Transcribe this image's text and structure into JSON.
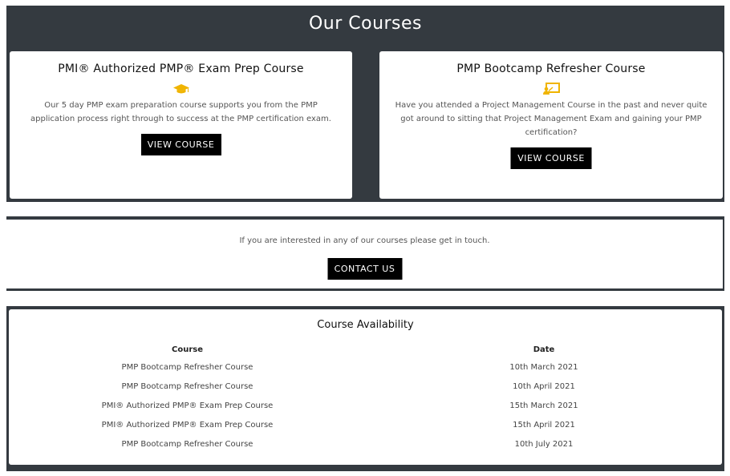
{
  "courses": {
    "title": "Our Courses",
    "cards": [
      {
        "title": "PMI® Authorized PMP® Exam Prep Course",
        "icon": "graduation-cap-icon",
        "description": "Our 5 day PMP exam preparation course supports you from the PMP application process right through to success at the PMP certification exam.",
        "button_label": "VIEW COURSE"
      },
      {
        "title": "PMP Bootcamp Refresher Course",
        "icon": "presentation-board-icon",
        "description": "Have you attended a Project Management Course in the past and never quite got around to sitting that Project Management Exam and gaining your PMP certification?",
        "button_label": "VIEW COURSE"
      }
    ]
  },
  "contact": {
    "text": "If you are interested in any of our courses please get in touch.",
    "button_label": "CONTACT US"
  },
  "availability": {
    "title": "Course Availability",
    "headers": [
      "Course",
      "Date"
    ],
    "rows": [
      [
        "PMP Bootcamp Refresher Course",
        "10th March 2021"
      ],
      [
        "PMP Bootcamp Refresher Course",
        "10th April 2021"
      ],
      [
        "PMI® Authorized PMP® Exam Prep Course",
        "15th March 2021"
      ],
      [
        "PMI® Authorized PMP® Exam Prep Course",
        "15th April 2021"
      ],
      [
        "PMP Bootcamp Refresher Course",
        "10th July 2021"
      ]
    ]
  },
  "colors": {
    "dark_background": "#343a40",
    "icon_accent": "#f0b400",
    "button_background": "#000000"
  }
}
